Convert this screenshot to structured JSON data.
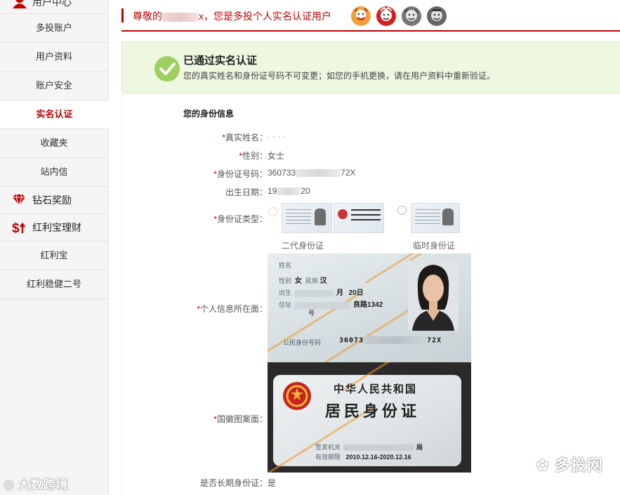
{
  "sidebar": {
    "header": "用户中心",
    "items": [
      "多投账户",
      "用户资料",
      "账户安全",
      "实名认证",
      "收藏夹",
      "站内信"
    ],
    "active": "实名认证",
    "groups": [
      {
        "label": "钻石奖励",
        "icon": "diamond-icon"
      },
      {
        "label": "红利宝理财",
        "icon": "dollar-arrow-icon"
      }
    ],
    "sub_items": [
      "红利宝",
      "红利稳健二号"
    ]
  },
  "topbar": {
    "greeting_prefix": "尊敬的",
    "greeting_suffix": "x，您是多投个人实名认证用户"
  },
  "notice": {
    "title": "已通过实名认证",
    "desc": "您的真实姓名和身份证号码不可变更；如您的手机更换，请在用户资料中重新验证。"
  },
  "identity": {
    "section_title": "您的身份信息",
    "real_name_label": "真实姓名：",
    "real_name_value": "·  ·  ·  ·",
    "gender_label": "性别：",
    "gender_value": "女士",
    "id_number_label": "身份证号码：",
    "id_number_prefix": "360733",
    "id_number_suffix": "72X",
    "birth_label": "出生日期：",
    "birth_prefix": "19",
    "birth_suffix": "20",
    "id_type_label": "身份证类型：",
    "id_type_options": [
      "二代身份证",
      "临时身份证"
    ],
    "front_label": "个人信息所在面：",
    "back_label": "国徽图案面：",
    "long_term_label": "是否长期身份证：",
    "long_term_value": "是"
  },
  "front_card": {
    "name_field": "姓名",
    "gender_field": "性别",
    "gender_value": "女",
    "ethnicity_field": "民族",
    "ethnicity_value": "汉",
    "birth_field": "出生",
    "birth_month": "月",
    "birth_day": "20日",
    "address_field": "住址",
    "address_value": "良路1342",
    "address_no": "号",
    "id_field": "公民身份号码",
    "id_prefix": "36073",
    "id_suffix": "72X"
  },
  "back_card": {
    "title1": "中华人民共和国",
    "title2": "居民身份证",
    "authority_label": "签发机关",
    "authority_suffix": "局",
    "validity_label": "有效期限",
    "validity_value": "2010.12.16-2020.12.16"
  },
  "watermarks": {
    "left": "大数跨境",
    "right": "多投网"
  },
  "colors": {
    "brand_red": "#c40000",
    "notice_bg": "#eef7e0",
    "check_green": "#9fcf5f"
  }
}
